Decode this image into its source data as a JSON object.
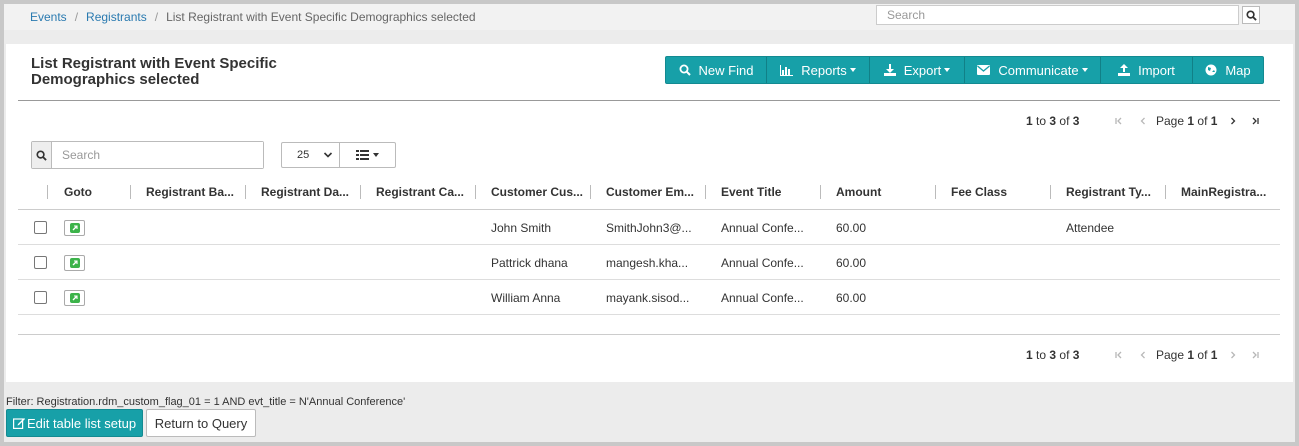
{
  "breadcrumb": {
    "items": [
      "Events",
      "Registrants"
    ],
    "current": "List Registrant with Event Specific Demographics selected"
  },
  "top_search": {
    "placeholder": "Search"
  },
  "page": {
    "title_line1": "List Registrant with Event Specific",
    "title_line2": "Demographics selected"
  },
  "toolbar": {
    "new_find": "New Find",
    "reports": "Reports",
    "export": "Export",
    "communicate": "Communicate",
    "import": "Import",
    "map": "Map"
  },
  "pager": {
    "from": "1",
    "to_word": "to",
    "to": "3",
    "of_word": "of",
    "total": "3",
    "page_word": "Page",
    "page": "1",
    "of_word2": "of",
    "pages": "1"
  },
  "grid_search": {
    "placeholder": "Search"
  },
  "page_size": "25",
  "columns": [
    "Goto",
    "Registrant Ba...",
    "Registrant Da...",
    "Registrant Ca...",
    "Customer Cus...",
    "Customer Em...",
    "Event Title",
    "Amount",
    "Fee Class",
    "Registrant Ty...",
    "MainRegistra..."
  ],
  "rows": [
    {
      "customer": "John Smith",
      "email": "SmithJohn3@...",
      "event": "Annual Confe...",
      "amount": "60.00",
      "type": "Attendee"
    },
    {
      "customer": "Pattrick dhana",
      "email": "mangesh.kha...",
      "event": "Annual Confe...",
      "amount": "60.00",
      "type": ""
    },
    {
      "customer": "William Anna",
      "email": "mayank.sisod...",
      "event": "Annual Confe...",
      "amount": "60.00",
      "type": ""
    }
  ],
  "filter": "Filter: Registration.rdm_custom_flag_01 = 1 AND evt_title = N'Annual Conference'",
  "buttons": {
    "edit": "Edit table list setup",
    "return": "Return to Query"
  },
  "colors": {
    "accent": "#17a0a8",
    "link": "#2a7ab0",
    "goto_icon": "#3cb34a"
  }
}
